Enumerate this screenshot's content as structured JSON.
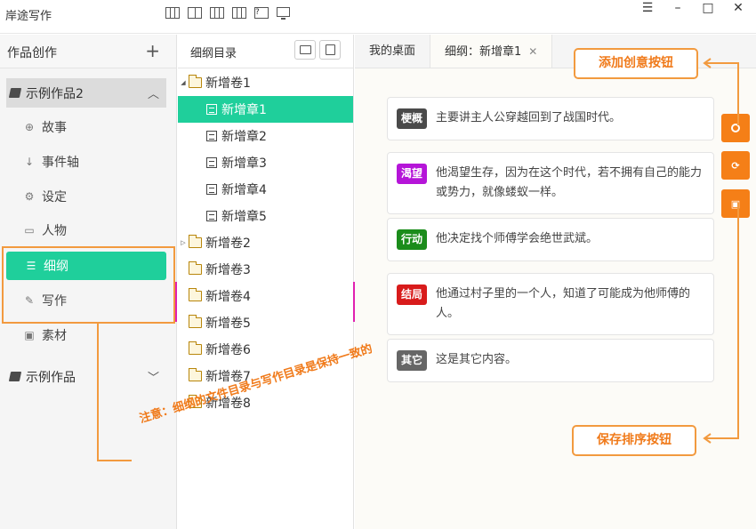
{
  "app": {
    "title": "岸途写作"
  },
  "sidebar": {
    "header": "作品创作",
    "works": [
      {
        "label": "示例作品2"
      },
      {
        "label": "示例作品"
      }
    ],
    "items": [
      {
        "label": "故事",
        "icon": "globe-icon"
      },
      {
        "label": "事件轴",
        "icon": "sort-icon"
      },
      {
        "label": "设定",
        "icon": "gears-icon"
      },
      {
        "label": "人物",
        "icon": "id-card-icon"
      },
      {
        "label": "细纲",
        "icon": "list-icon"
      },
      {
        "label": "写作",
        "icon": "pencil-icon"
      },
      {
        "label": "素材",
        "icon": "image-icon"
      }
    ]
  },
  "directory": {
    "header": "细纲目录",
    "tree": [
      {
        "label": "新增卷1"
      },
      {
        "label": "新增章1"
      },
      {
        "label": "新增章2"
      },
      {
        "label": "新增章3"
      },
      {
        "label": "新增章4"
      },
      {
        "label": "新增章5"
      },
      {
        "label": "新增卷2"
      },
      {
        "label": "新增卷3"
      },
      {
        "label": "新增卷4"
      },
      {
        "label": "新增卷5"
      },
      {
        "label": "新增卷6"
      },
      {
        "label": "新增卷7"
      },
      {
        "label": "新增卷8"
      }
    ]
  },
  "tabs": [
    {
      "label": "我的桌面"
    },
    {
      "label": "细纲：新增章1"
    }
  ],
  "cards": [
    {
      "tag": "梗概",
      "color": "#4a4a4a",
      "text": "主要讲主人公穿越回到了战国时代。"
    },
    {
      "tag": "渴望",
      "color": "#b515d8",
      "text": "他渴望生存，因为在这个时代，若不拥有自己的能力或势力，就像蝼蚁一样。"
    },
    {
      "tag": "行动",
      "color": "#1b8c1b",
      "text": "他决定找个师傅学会绝世武斌。"
    },
    {
      "tag": "结局",
      "color": "#d81b1b",
      "text": "他通过村子里的一个人，知道了可能成为他师傅的人。"
    },
    {
      "tag": "其它",
      "color": "#666666",
      "text": "这是其它内容。"
    }
  ],
  "annotations": {
    "add_button": "添加创意按钮",
    "save_button": "保存排序按钮",
    "note": "注意：细纲的文件目录与写作目录是保持一致的"
  }
}
